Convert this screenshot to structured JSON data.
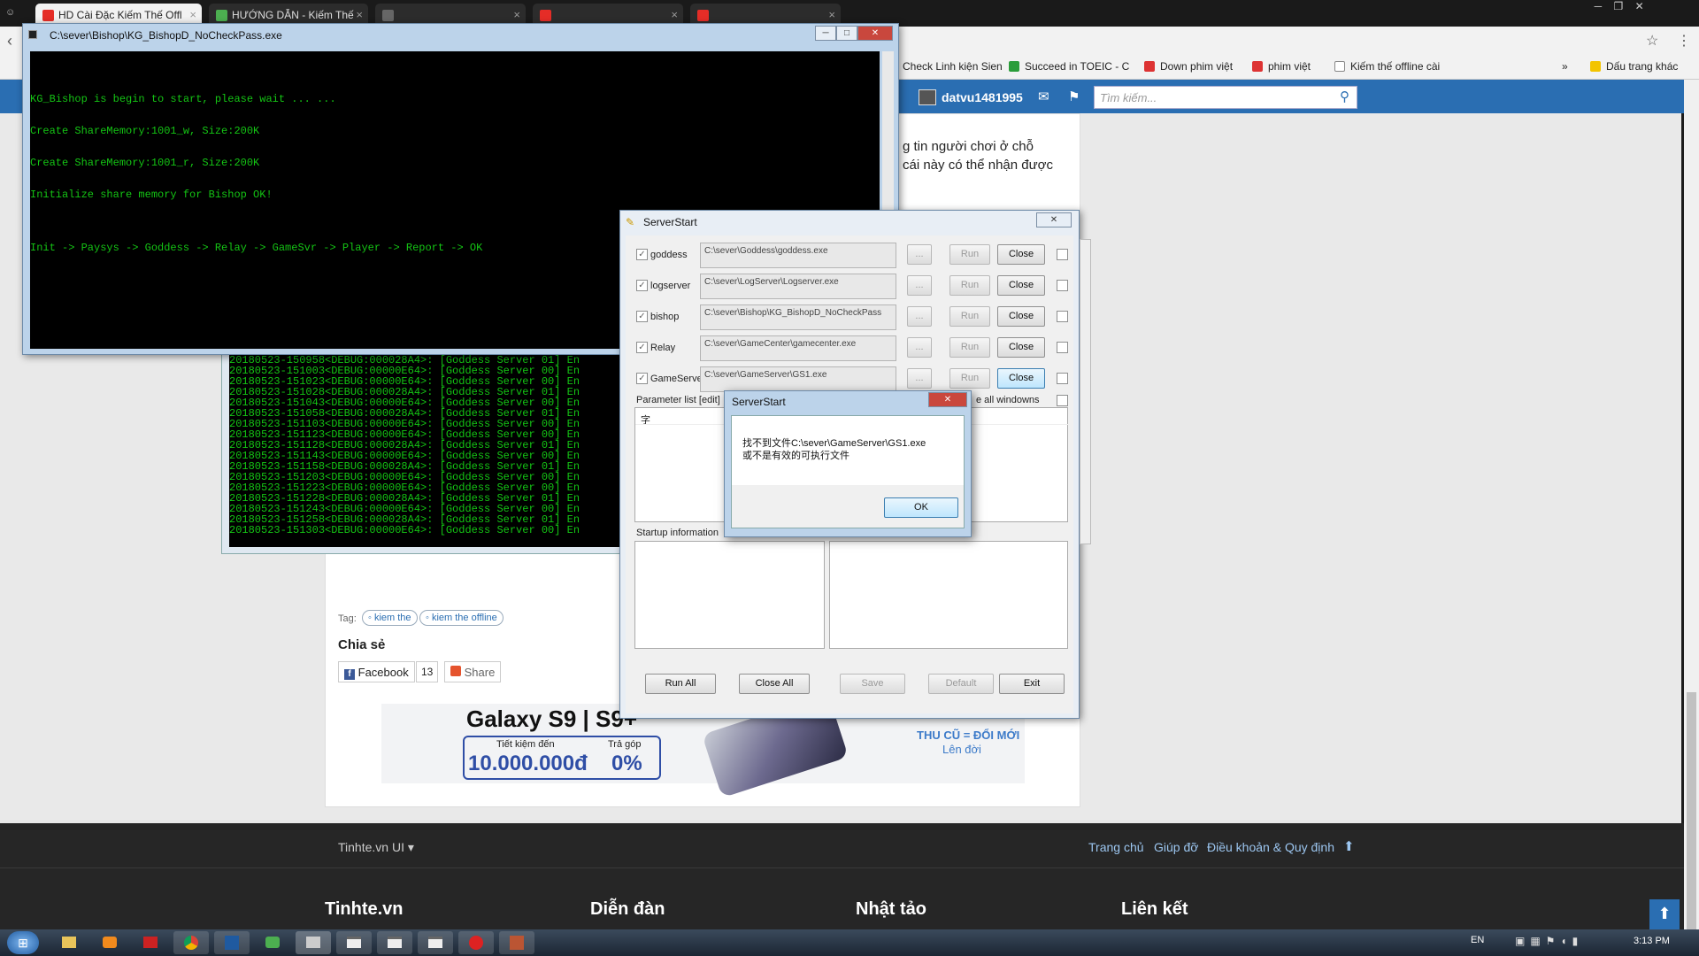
{
  "browser": {
    "tabs": [
      {
        "label": "HD Cài Đặc Kiếm Thế Offl",
        "icon": "youtube-icon",
        "color": "#e52d27"
      },
      {
        "label": "HƯỚNG DẪN - Kiếm Thế",
        "icon": "leaf-icon",
        "color": "#4caf50"
      },
      {
        "label": "",
        "icon": "page-icon",
        "color": "#777"
      },
      {
        "label": "",
        "icon": "youtube-icon",
        "color": "#e52d27"
      },
      {
        "label": "",
        "icon": "youtube-icon",
        "color": "#e52d27"
      }
    ],
    "bookmarks": [
      {
        "label": "Check Linh kiện Sien",
        "color": "#888"
      },
      {
        "label": "Succeed in TOEIC - C",
        "color": "#2a9d3a"
      },
      {
        "label": "Down phim việt",
        "color": "#d33"
      },
      {
        "label": "phim việt",
        "color": "#d33"
      },
      {
        "label": "Kiếm thế offline cài",
        "color": "#888"
      },
      {
        "label": "»",
        "color": ""
      },
      {
        "label": "Dấu trang khác",
        "color": "#f3c400"
      }
    ]
  },
  "site": {
    "username": "datvu1481995",
    "search_placeholder": "Tìm kiếm...",
    "text_line1": "g tin người chơi ở chỗ",
    "text_line2": "cái này có thể nhận được",
    "tag_label": "Tag:",
    "tags": [
      "kiem the",
      "kiem the offline"
    ],
    "share_heading": "Chia sẻ",
    "facebook_label": "Facebook",
    "facebook_count": "13",
    "share_label": "Share",
    "ad": {
      "title": "Galaxy S9 | S9+",
      "save_label": "Tiết kiệm đến",
      "save_value": "10.000.000đ",
      "install_label": "Trả góp",
      "install_value": "0%",
      "trade_label": "THU CŨ = ĐỔI MỚI",
      "trade_sub": "Lên đời"
    },
    "footer": {
      "menu": "Tinhte.vn UI ▾",
      "links": [
        "Trang chủ",
        "Giúp đỡ",
        "Điều khoản & Quy định"
      ],
      "headings": [
        "Tinhte.vn",
        "Diễn đàn",
        "Nhật tảo",
        "Liên kết"
      ]
    }
  },
  "console": {
    "title": "C:\\sever\\Bishop\\KG_BishopD_NoCheckPass.exe",
    "lines": [
      "",
      "KG_Bishop is begin to start, please wait ... ...",
      "Create ShareMemory:1001_w, Size:200K",
      "Create ShareMemory:1001_r, Size:200K",
      "Initialize share memory for Bishop OK!",
      "",
      "Init -> Paysys -> Goddess -> Relay -> GameSvr -> Player -> Report -> OK"
    ]
  },
  "background_console": {
    "lines": [
      "20180523-150958<DEBUG:000028A4>: [Goddess Server 01] En",
      "20180523-151003<DEBUG:00000E64>: [Goddess Server 00] En",
      "20180523-151023<DEBUG:00000E64>: [Goddess Server 00] En",
      "20180523-151028<DEBUG:000028A4>: [Goddess Server 01] En",
      "20180523-151043<DEBUG:00000E64>: [Goddess Server 00] En",
      "20180523-151058<DEBUG:000028A4>: [Goddess Server 01] En",
      "20180523-151103<DEBUG:00000E64>: [Goddess Server 00] En",
      "20180523-151123<DEBUG:00000E64>: [Goddess Server 00] En",
      "20180523-151128<DEBUG:000028A4>: [Goddess Server 01] En",
      "20180523-151143<DEBUG:00000E64>: [Goddess Server 00] En",
      "20180523-151158<DEBUG:000028A4>: [Goddess Server 01] En",
      "20180523-151203<DEBUG:00000E64>: [Goddess Server 00] En",
      "20180523-151223<DEBUG:00000E64>: [Goddess Server 00] En",
      "20180523-151228<DEBUG:000028A4>: [Goddess Server 01] En",
      "20180523-151243<DEBUG:00000E64>: [Goddess Server 00] En",
      "20180523-151258<DEBUG:000028A4>: [Goddess Server 01] En",
      "20180523-151303<DEBUG:00000E64>: [Goddess Server 00] En"
    ]
  },
  "serverstart": {
    "title": "ServerStart",
    "servers": [
      {
        "name": "goddess",
        "path": "C:\\sever\\Goddess\\goddess.exe"
      },
      {
        "name": "logserver",
        "path": "C:\\sever\\LogServer\\Logserver.exe"
      },
      {
        "name": "bishop",
        "path": "C:\\sever\\Bishop\\KG_BishopD_NoCheckPass"
      },
      {
        "name": "Relay",
        "path": "C:\\sever\\GameCenter\\gamecenter.exe"
      },
      {
        "name": "GameServer",
        "path": "C:\\sever\\GameServer\\GS1.exe"
      }
    ],
    "browse_label": "...",
    "run_label": "Run",
    "close_label": "Close",
    "param_label": "Parameter list [edit]",
    "hide_label": "e all windowns",
    "param_value": "字",
    "startup_label": "Startup information",
    "buttons": {
      "run_all": "Run All",
      "close_all": "Close All",
      "save": "Save",
      "default": "Default",
      "exit": "Exit"
    }
  },
  "dialog": {
    "title": "ServerStart",
    "message_line1": "找不到文件C:\\sever\\GameServer\\GS1.exe",
    "message_line2": "或不是有效的可执行文件",
    "ok_label": "OK"
  },
  "taskbar": {
    "lang": "EN",
    "time": "3:13 PM"
  }
}
